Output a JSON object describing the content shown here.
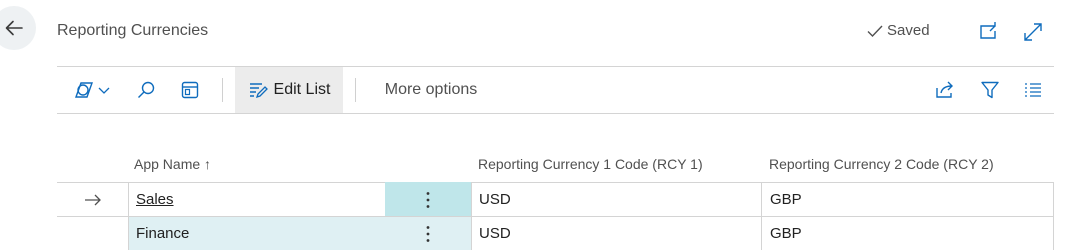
{
  "header": {
    "title": "Reporting Currencies",
    "saved_label": "Saved"
  },
  "toolbar": {
    "edit_list_label": "Edit List",
    "more_options_label": "More options"
  },
  "table": {
    "columns": {
      "app_name": "App Name",
      "sort_indicator": "↑",
      "rcy1": "Reporting Currency 1 Code (RCY 1)",
      "rcy2": "Reporting Currency 2 Code (RCY 2)"
    },
    "rows": [
      {
        "app_name": "Sales",
        "rcy1": "USD",
        "rcy2": "GBP",
        "current": true
      },
      {
        "app_name": "Finance",
        "rcy1": "USD",
        "rcy2": "GBP",
        "current": false
      }
    ]
  },
  "colors": {
    "accent": "#0f6cbd",
    "selected_cell_bg": "#dff0f3",
    "action_cell_bg": "#bfe6ea",
    "row_marker": "#505050"
  },
  "icons": [
    "back-arrow-icon",
    "check-icon",
    "open-new-window-icon",
    "expand-icon",
    "copilot-analyze-icon",
    "chevron-down-icon",
    "search-icon",
    "personalize-icon",
    "edit-list-icon",
    "share-icon",
    "filter-icon",
    "list-view-icon",
    "row-current-arrow-icon",
    "row-actions-icon"
  ]
}
